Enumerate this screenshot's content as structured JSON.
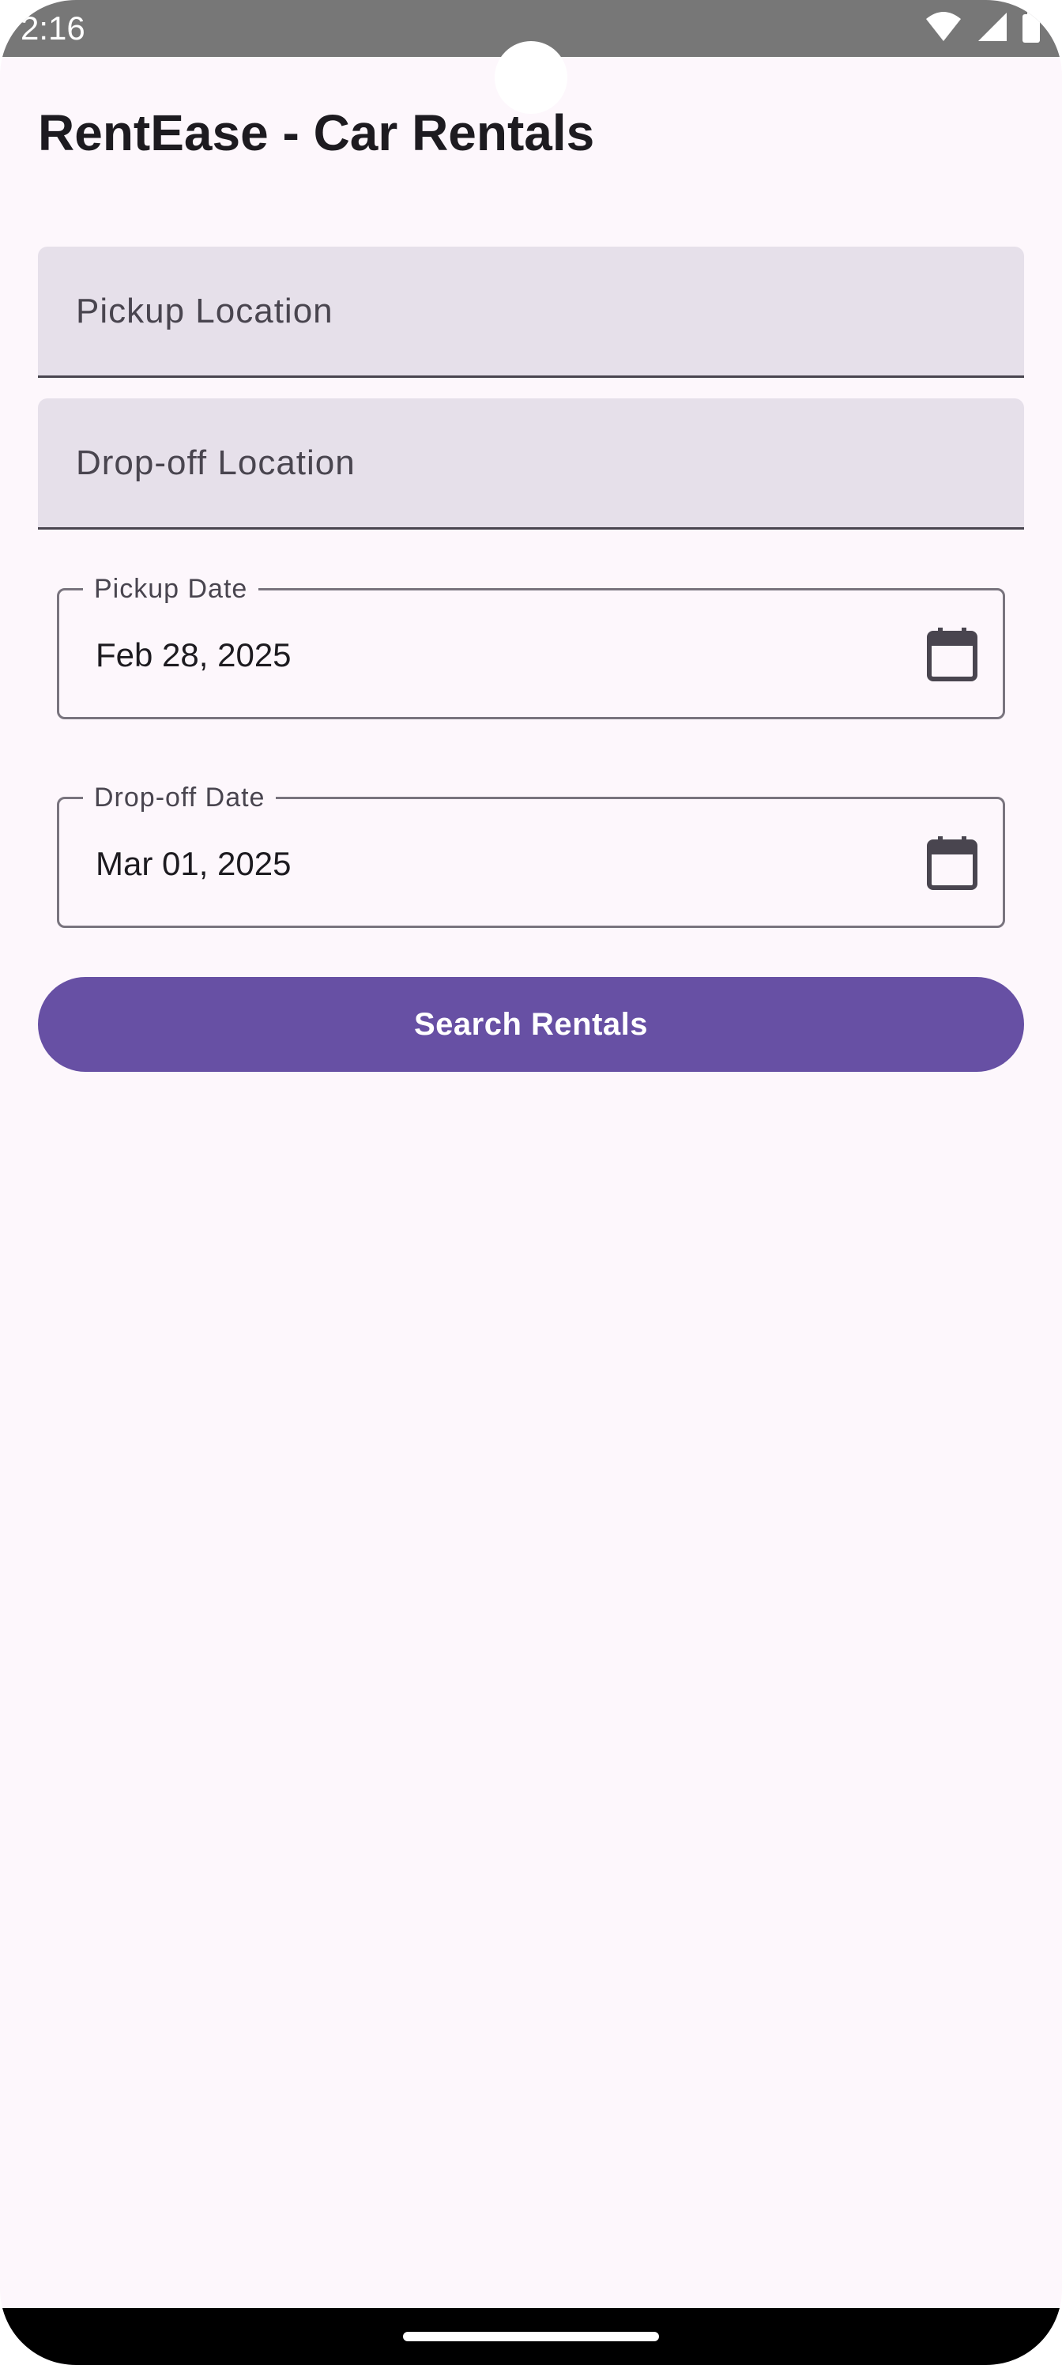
{
  "status_bar": {
    "time": "2:16",
    "icons": [
      "wifi-icon",
      "signal-icon",
      "battery-icon"
    ]
  },
  "app": {
    "title": "RentEase - Car Rentals"
  },
  "form": {
    "pickup_location": {
      "placeholder": "Pickup Location",
      "value": ""
    },
    "dropoff_location": {
      "placeholder": "Drop-off Location",
      "value": ""
    },
    "pickup_date": {
      "label": "Pickup Date",
      "value": "Feb 28, 2025",
      "icon": "calendar-icon"
    },
    "dropoff_date": {
      "label": "Drop-off Date",
      "value": "Mar 01, 2025",
      "icon": "calendar-icon"
    },
    "search_label": "Search Rentals"
  },
  "colors": {
    "primary": "#6750a4",
    "background": "#fdf7fc",
    "field_fill": "#e6e0ea",
    "outline": "#79747e",
    "on_surface": "#1d1b20"
  }
}
